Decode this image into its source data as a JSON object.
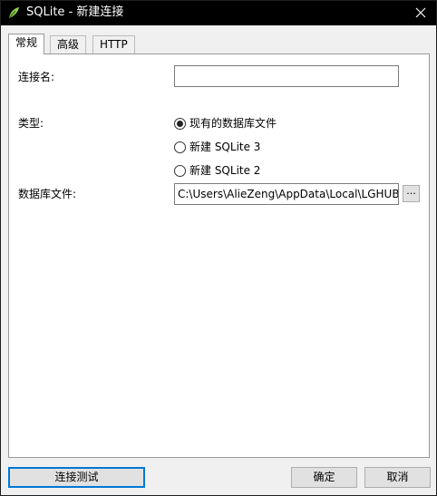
{
  "window": {
    "title": "SQLite - 新建连接",
    "close_glyph": "✕"
  },
  "tabs": [
    {
      "label": "常规",
      "active": true
    },
    {
      "label": "高级",
      "active": false
    },
    {
      "label": "HTTP",
      "active": false
    }
  ],
  "form": {
    "connection_name_label": "连接名:",
    "connection_name_value": "",
    "type_label": "类型:",
    "type_options": [
      {
        "label": "现有的数据库文件",
        "checked": true
      },
      {
        "label": "新建 SQLite 3",
        "checked": false
      },
      {
        "label": "新建 SQLite 2",
        "checked": false
      }
    ],
    "db_file_label": "数据库文件:",
    "db_file_value": "C:\\Users\\AlieZeng\\AppData\\Local\\LGHUB\\",
    "browse_label": "..."
  },
  "buttons": {
    "test_label": "连接测试",
    "ok_label": "确定",
    "cancel_label": "取消"
  },
  "colors": {
    "titlebar": "#000000",
    "accent_focus": "#0078d7",
    "icon_leaf": "#8fd14f"
  },
  "icons": {
    "app": "feather-icon",
    "close": "close-icon"
  }
}
